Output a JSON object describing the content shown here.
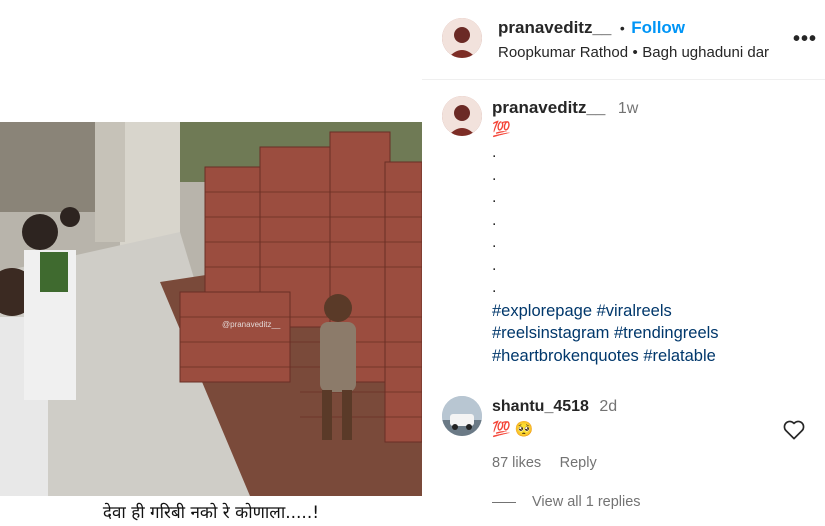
{
  "post": {
    "username": "pranaveditz__",
    "follow_label": "Follow",
    "separator": "•",
    "audio_artist": "Roopkumar Rathod",
    "audio_title": "Bagh ughaduni dar",
    "more_label": "•••"
  },
  "media": {
    "caption_text": "देवा ही गरिबी नको रे कोणाला.....!",
    "watermark": "@pranaveditz__"
  },
  "caption": {
    "username": "pranaveditz__",
    "time": "1w",
    "emoji": "💯",
    "dots": [
      ".",
      ".",
      ".",
      ".",
      ".",
      ".",
      "."
    ],
    "hashtag_lines": [
      "#explorepage #viralreels",
      "#reelsinstagram #trendingreels",
      "#heartbrokenquotes #relatable"
    ]
  },
  "comment": {
    "username": "shantu_4518",
    "time": "2d",
    "text": "💯 🥺",
    "likes": "87 likes",
    "reply_label": "Reply",
    "view_replies": "View all 1 replies"
  },
  "colors": {
    "link": "#00376b",
    "follow": "#0095f6",
    "muted": "#737373"
  }
}
